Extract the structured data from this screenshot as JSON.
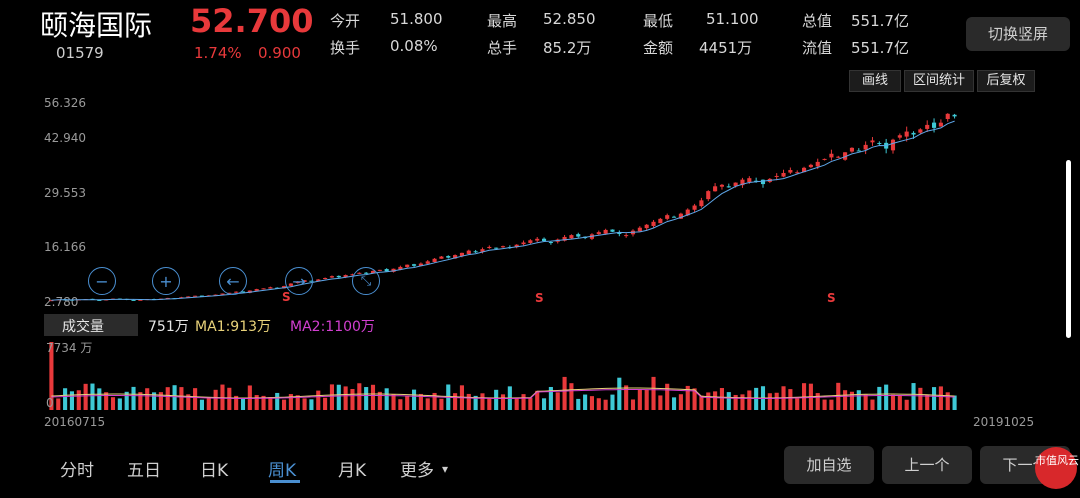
{
  "header": {
    "name": "颐海国际",
    "price": "52.700",
    "code": "01579",
    "change_pct": "1.74%",
    "change": "0.900",
    "rotate_button": "切换竖屏"
  },
  "quote": {
    "open_label": "今开",
    "open": "51.800",
    "high_label": "最高",
    "high": "52.850",
    "low_label": "最低",
    "low": "51.100",
    "mktcap_label": "总值",
    "mktcap": "551.7亿",
    "turnover_label": "换手",
    "turnover": "0.08%",
    "volume_label": "总手",
    "volume": "85.2万",
    "amount_label": "金额",
    "amount": "4451万",
    "float_label": "流值",
    "float": "551.7亿"
  },
  "chart_tools": {
    "draw": "画线",
    "interval": "区间统计",
    "adjust": "后复权"
  },
  "price_axis": [
    "56.326",
    "42.940",
    "29.553",
    "16.166",
    "2.780"
  ],
  "indicators": {
    "label": "成交量",
    "volume": "751万",
    "ma1": "MA1:913万",
    "ma2": "MA2:1100万",
    "vol_axis_top": "7734 万",
    "vol_axis_bottom": "0"
  },
  "dates": {
    "start": "20160715",
    "end": "20191025"
  },
  "markers": [
    "S",
    "S",
    "S"
  ],
  "tabs": [
    "分时",
    "五日",
    "日K",
    "周K",
    "月K",
    "更多"
  ],
  "active_tab": "周K",
  "actions": {
    "add_watch": "加自选",
    "prev": "上一个",
    "next": "下一个"
  },
  "logo_text": "市值风云",
  "colors": {
    "up": "#e8393b",
    "down": "#3ec9d6",
    "ma1": "#e8d27a",
    "ma2": "#d23fd0",
    "ma5": "#5ea6e8"
  },
  "chart_data": {
    "type": "candlestick",
    "title": "",
    "xlabel": "",
    "ylabel": "",
    "x_range": [
      "20160715",
      "20191025"
    ],
    "ylim": [
      2.78,
      56.326
    ],
    "y_ticks": [
      56.326,
      42.94,
      29.553,
      16.166,
      2.78
    ],
    "closes": [
      3.0,
      3.2,
      3.1,
      3.0,
      3.2,
      3.3,
      3.1,
      3.0,
      3.2,
      3.4,
      3.3,
      3.1,
      3.0,
      3.1,
      3.3,
      3.2,
      3.4,
      3.6,
      3.5,
      3.8,
      4.0,
      4.2,
      4.1,
      4.3,
      4.5,
      4.8,
      5.0,
      5.3,
      5.1,
      5.6,
      6.0,
      6.2,
      6.5,
      6.3,
      6.8,
      7.5,
      8.0,
      8.4,
      8.1,
      8.6,
      9.0,
      9.5,
      9.2,
      9.8,
      10.0,
      10.4,
      10.2,
      10.9,
      11.2,
      10.8,
      11.5,
      12.0,
      12.6,
      12.3,
      12.9,
      13.5,
      14.2,
      14.8,
      14.5,
      15.2,
      15.8,
      16.4,
      16.0,
      16.8,
      17.4,
      17.0,
      17.6,
      17.2,
      18.0,
      18.6,
      19.2,
      19.6,
      19.0,
      18.5,
      19.4,
      20.1,
      20.6,
      20.2,
      19.8,
      20.8,
      21.4,
      22.0,
      21.5,
      20.9,
      20.6,
      21.8,
      22.6,
      23.4,
      24.2,
      25.0,
      26.0,
      25.4,
      26.4,
      27.5,
      28.6,
      30.0,
      32.5,
      33.8,
      34.2,
      33.5,
      34.8,
      35.6,
      36.0,
      35.2,
      34.4,
      35.8,
      36.6,
      37.4,
      38.2,
      37.6,
      38.8,
      39.6,
      40.4,
      41.2,
      42.6,
      41.8,
      43.0,
      44.2,
      43.4,
      45.0,
      46.2,
      45.4,
      44.0,
      46.4,
      47.6,
      48.6,
      47.8,
      49.2,
      50.4,
      49.6,
      51.0,
      53.4,
      52.7
    ],
    "volume_axis": [
      "7734万",
      "0"
    ],
    "volume_series": [
      {
        "name": "成交量",
        "last": 751
      },
      {
        "name": "MA1",
        "last": 913
      },
      {
        "name": "MA2",
        "last": 1100
      }
    ]
  }
}
